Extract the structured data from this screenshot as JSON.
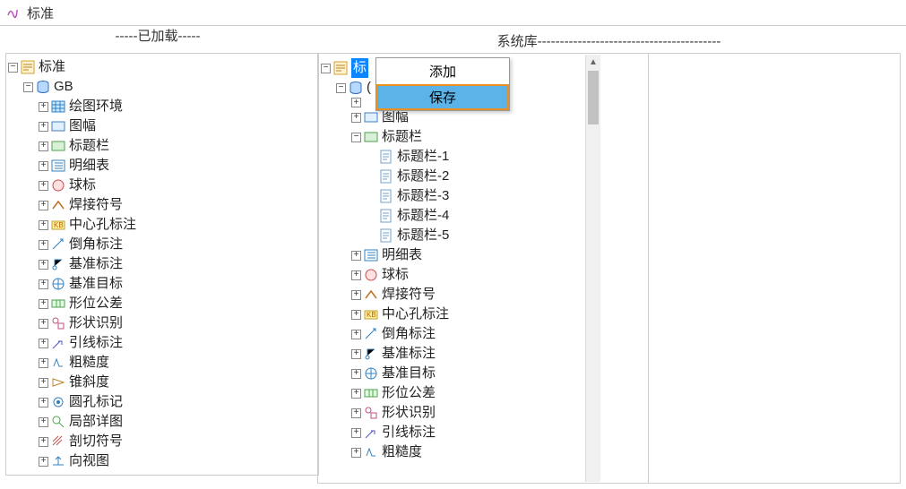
{
  "title": "标准",
  "panels": {
    "loaded_header": "-----已加载-----",
    "system_header": "系统库-----------------------------------------"
  },
  "left_tree": {
    "root": "标准",
    "gb": "GB",
    "items": [
      "绘图环境",
      "图幅",
      "标题栏",
      "明细表",
      "球标",
      "焊接符号",
      "中心孔标注",
      "倒角标注",
      "基准标注",
      "基准目标",
      "形位公差",
      "形状识别",
      "引线标注",
      "粗糙度",
      "锥斜度",
      "圆孔标记",
      "局部详图",
      "剖切符号",
      "向视图"
    ]
  },
  "right_tree": {
    "root": "标准",
    "root_partial": "标",
    "gb_partial": "(",
    "level2_a": "图幅",
    "level2_b": "标题栏",
    "title_items": [
      "标题栏-1",
      "标题栏-2",
      "标题栏-3",
      "标题栏-4",
      "标题栏-5"
    ],
    "rest": [
      "明细表",
      "球标",
      "焊接符号",
      "中心孔标注",
      "倒角标注",
      "基准标注",
      "基准目标",
      "形位公差",
      "形状识别",
      "引线标注",
      "粗糙度"
    ]
  },
  "context_menu": {
    "add": "添加",
    "save": "保存"
  }
}
